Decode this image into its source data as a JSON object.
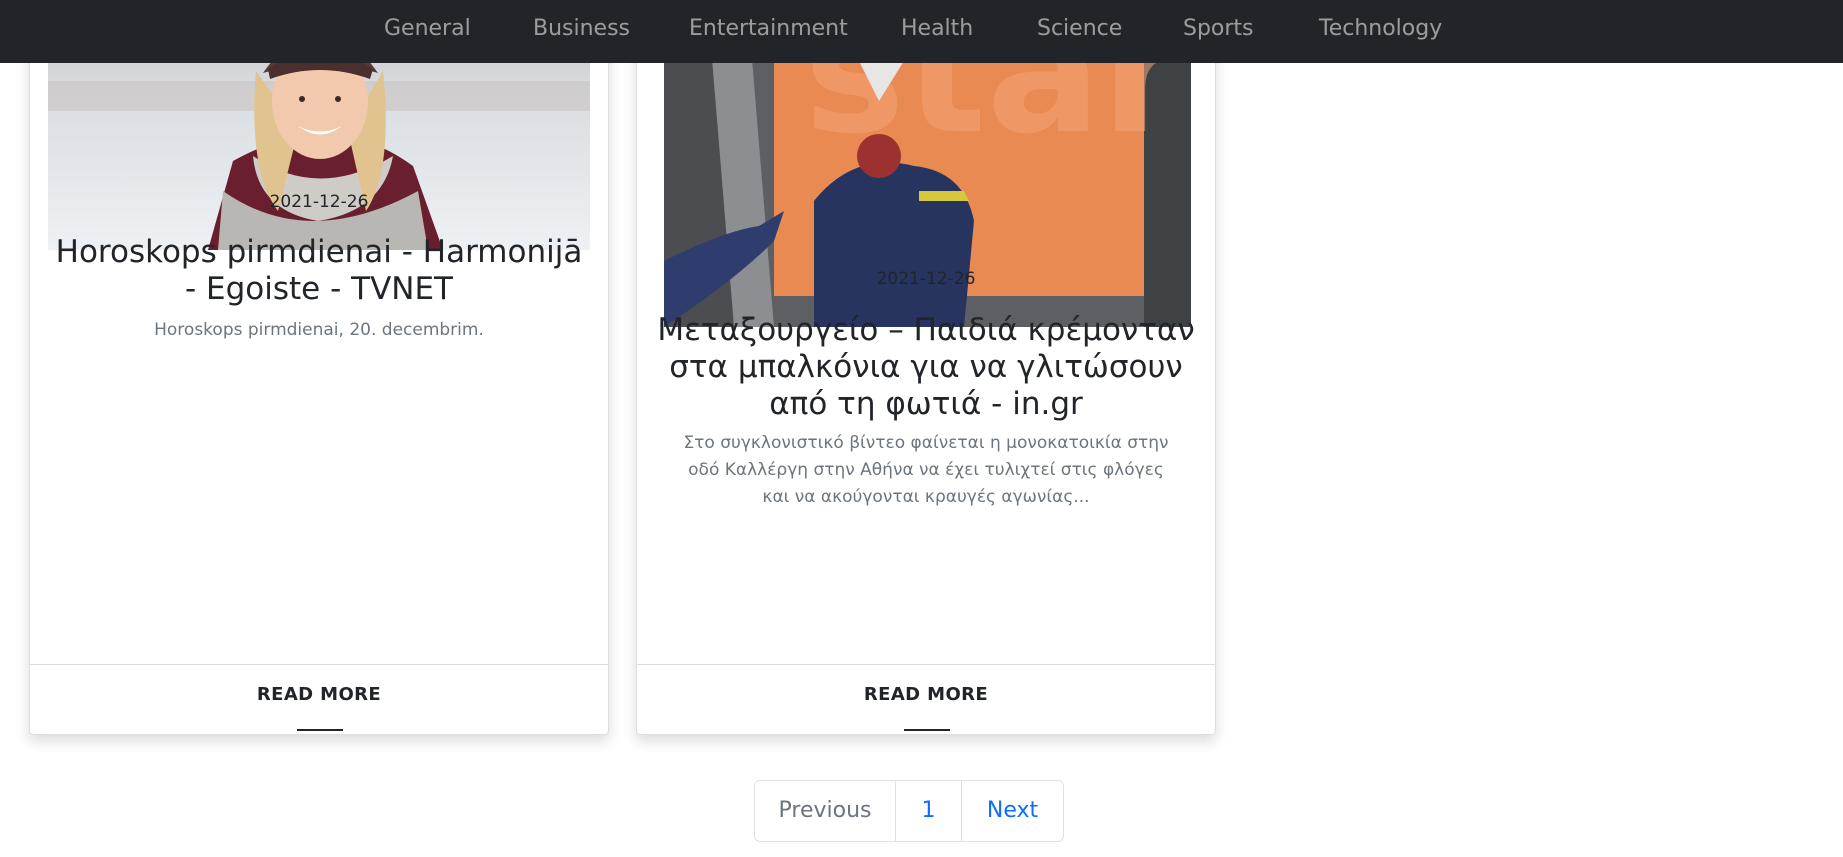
{
  "nav": {
    "items": [
      "General",
      "Business",
      "Entertainment",
      "Health",
      "Science",
      "Sports",
      "Technology"
    ]
  },
  "cards": [
    {
      "date": "2021-12-26",
      "title": "Horoskops pirmdienai - Harmonijā - Egoiste - TVNET",
      "description": "Horoskops pirmdienai, 20. decembrim.",
      "read_more": "READ MORE"
    },
    {
      "date": "2021-12-26",
      "title": "Μεταξουργείο – Παιδιά κρέμονταν στα μπαλκόνια για να γλιτώσουν από τη φωτιά - in.gr",
      "description": "Στο συγκλονιστικό βίντεο φαίνεται η μονοκατοικία στην οδό Καλλέργη στην Αθήνα να έχει τυλιχτεί στις φλόγες και να ακούγονται κραυγές αγωνίας...",
      "read_more": "READ MORE"
    }
  ],
  "pagination": {
    "previous": "Previous",
    "page": "1",
    "next": "Next"
  },
  "colors": {
    "navbar_bg": "#212529",
    "nav_text": "#8f9193",
    "link_blue": "#0d6efd",
    "muted": "#6c757d"
  }
}
